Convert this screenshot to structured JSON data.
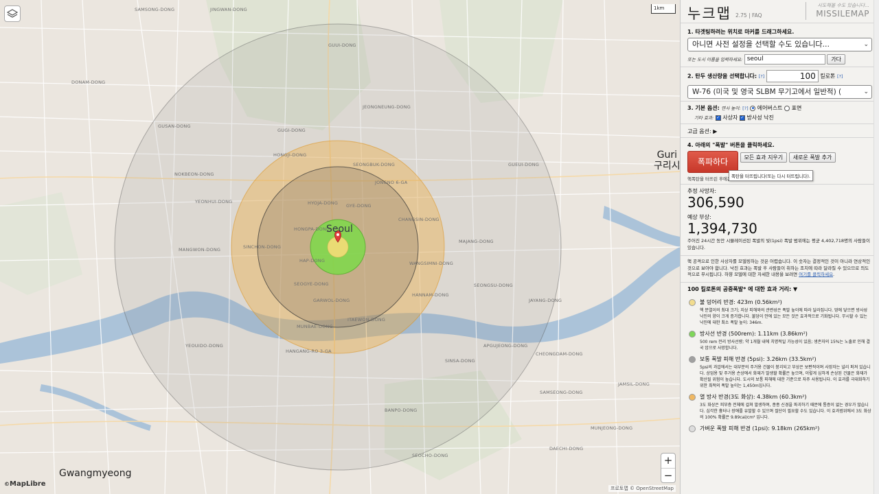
{
  "map": {
    "seoul_label": "Seoul",
    "scale": "1km",
    "zoom_in": "+",
    "zoom_out": "−",
    "logo": "MapLibre",
    "attribution": "프로토맵 © OpenStreetMap",
    "cities": [
      {
        "en": "Guri",
        "ko": "구리시"
      },
      {
        "en": "Gwangmyeong",
        "ko": ""
      }
    ],
    "districts": [
      "SAMSONG-DONG",
      "JINGWAN-DONG",
      "GUUI-DONG",
      "JEONGNEUNG-DONG",
      "GUGI-DONG",
      "HONGJI-DONG",
      "SEONGBUK-DONG",
      "JONGNO 6-GA",
      "HYOJA-DONG",
      "GYE-DONG",
      "CHANGSIN-DONG",
      "HONGPA-DONG",
      "SINCHON-DONG",
      "HAP-DONG",
      "SEOGYE-DONG",
      "GARWOL-DONG",
      "ITAEWON-DONG",
      "MUNBAE-DONG",
      "HANNAM-DONG",
      "HANGANG-RO 3-GA",
      "YEOUIDO-DONG",
      "NOKBEON-DONG",
      "GUSAN-DONG",
      "DONAM-DONG",
      "YEONHUI-DONG",
      "MANGWON-DONG",
      "SEONGSU-DONG",
      "JAYANG-DONG",
      "GUEUI-DONG",
      "MAJANG-DONG",
      "WANGSIMNI-DONG",
      "MUNJEONG-DONG",
      "SINSA-DONG",
      "APGUJEONG-DONG",
      "CHEONGDAM-DONG",
      "SAMSEONG-DONG",
      "DAECHI-DONG",
      "JAMSIL-DONG",
      "BANPO-DONG",
      "SEOCHO-DONG"
    ]
  },
  "panel": {
    "logo": "누크맵",
    "version": "2.75 | FAQ",
    "tagline": "시도해볼 수도 있습니다...",
    "missilemap": "MISSILEMAP",
    "step1": "1. 타겟팅하려는 위치로 마커를 드래그하세요.",
    "preset_select": "아니면 사전 설정을 선택할 수도 있습니다...",
    "city_prompt": "또는 도시 이름을 입력하세요:",
    "city_value": "seoul",
    "go_btn": "가다",
    "step2": "2. 탄두 생산량을 선택합니다:",
    "q": "[?]",
    "yield_value": "100",
    "kiloton": "킬로톤",
    "warhead_select": "W-76 (미국 및 영국 SLBM 무기고에서 일반적) (",
    "step3": "3. 기본 옵션:",
    "burst_height": "연사 높이:",
    "airburst": "에어버스트",
    "surface": "표면",
    "other_effects": "기타 효과:",
    "casualties": "사상자",
    "fallout": "방사성 낙진",
    "advanced": "고급 옵션:",
    "advanced_arrow": "▶",
    "step4": "4. 아래의 \"폭발\" 버튼을 클릭하세요.",
    "detonate": "폭파하다",
    "clear_effects": "모든 효과 지우기",
    "add_detonation": "새로운 폭발 추가",
    "tooltip": "폭탄을 터뜨립니다(또는 다시 터뜨립니다).",
    "after_note": "핵폭탄을 터뜨린 후에는 표적 마커를 끌 수 있습니다.",
    "deaths_label": "추정 사망자:",
    "deaths": "306,590",
    "injuries_label": "예상 부상:",
    "injuries": "1,394,730",
    "population_note": "주어진 24시간 동안 시뮬레이션된 폭발의 빛(1psi) 폭발 범위에는 평균 4,402,718명의 사람들이 있습니다.",
    "disclaimer": "핵 공격으로 인한 사상자를 모델링하는 것은 어렵습니다. 이 숫자는 결정적인 것이 아니라 연상적인 것으로 보아야 합니다. 낙진 효과는 폭발 후 사람들이 취하는 조치에 따라 달라질 수 있으므로 의도적으로 무시됩니다. 하향 모델에 대한 자세한 내용을 보려면",
    "disclaimer_link": "여기를 클릭하세요",
    "effects_header": "100 킬로톤의 공중폭발* 에 대한 효과 거리: ▼",
    "effects": [
      {
        "color": "#f2dc8e",
        "title": "불 덩어리 반경: 423m (0.56km²)",
        "desc": "핵 분열이의 최대 크기; 지상 피해와의 관련성은 폭발 높이에 따라 달라집니다. 땅에 닿으면 방사성 낙진의 양이 크게 증가합니다. 불덩이 안에 있는 모든 것은 효과적으로 기화됩니다. 무시할 수 있는 낙진에 대한 최소 폭발 높이: 346m."
      },
      {
        "color": "#7fd65a",
        "title": "방사선 반경 (500rem): 1.11km (3.86km²)",
        "desc": "500 rem 전리 방사선량; 약 1개월 내에 치명적일 가능성이 있음; 생존자의 15%는 노출로 인해 결국 암으로 사망합니다."
      },
      {
        "color": "#a0a0a0",
        "title": "보통 폭발 피해 반경 (5psi): 3.26km (33.5km²)",
        "desc": "5psi의 과압에서는 대부분의 주거용 건물이 붕괴되고 부상은 보편적이며 사망자는 널리 퍼져 있습니다. 상업용 및 주거용 손상에서 화재가 발생할 확률은 높으며, 이렇게 심하게 손상된 건물은 화재가 확산될 위험이 높습니다. 도시의 보통 피해에 대한 기준으로 자주 사용됩니다. 이 효과를 극대화하기 위한 최적의 폭발 높이는 1,450m입니다."
      },
      {
        "color": "#f0b862",
        "title": "열 방사 반경(3도 화상): 4.38km (60.3km²)",
        "desc": "3도 화상은 피부층 전체에 걸쳐 발생하며, 종종 신경을 파괴하기 때문에 통증이 없는 경우가 많습니다. 심각한 흉터나 장애를 유발할 수 있으며 절단이 필요할 수도 있습니다. 이 효과범위에서 3도 화상의 100% 확률은 9.89cal/cm² 입니다."
      },
      {
        "color": "#dddddd",
        "title": "가벼운 폭발 피해 반경 (1psi): 9.18km (265km²)",
        "desc": ""
      }
    ]
  }
}
